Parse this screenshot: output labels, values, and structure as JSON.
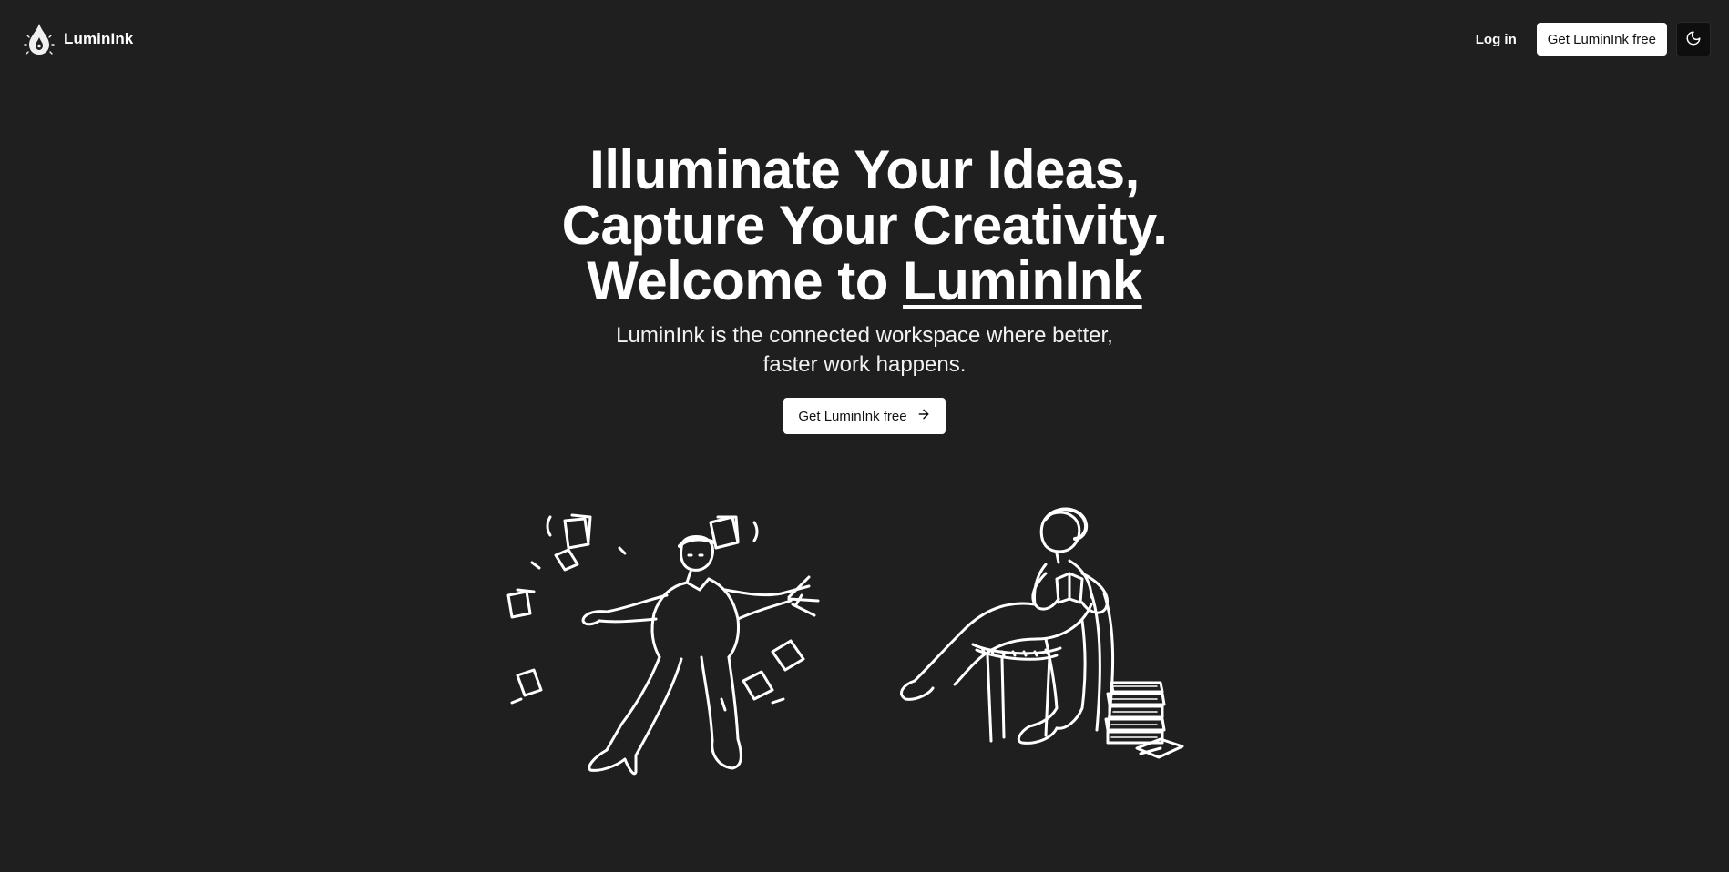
{
  "brand": {
    "name": "LuminInk",
    "logo_icon": "ink-drop-icon"
  },
  "nav": {
    "login_label": "Log in",
    "cta_label": "Get LuminInk free",
    "theme_icon": "moon-icon"
  },
  "hero": {
    "title_line1": "Illuminate Your Ideas,",
    "title_line2": "Capture Your Creativity.",
    "title_line3_prefix": "Welcome to ",
    "title_line3_brand": "LuminInk",
    "subtitle": "LuminInk is the connected workspace where better, faster work happens.",
    "cta_label": "Get LuminInk free",
    "cta_icon": "arrow-right-icon"
  },
  "illustrations": {
    "left": "juggling-papers-man-illustration",
    "right": "reading-woman-illustration"
  },
  "colors": {
    "background": "#1f1f1f",
    "text": "#ffffff",
    "button_bg": "#ffffff",
    "button_text": "#111111",
    "toggle_bg": "#0e0e0e"
  }
}
